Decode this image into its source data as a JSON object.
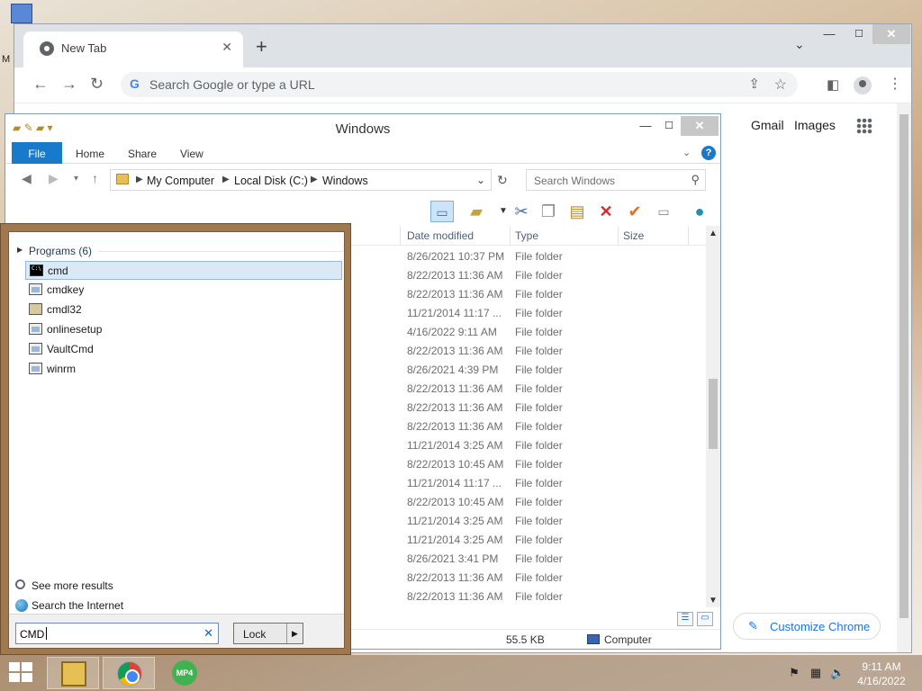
{
  "chrome": {
    "tab_title": "New Tab",
    "omnibox_placeholder": "Search Google or type a URL",
    "links": {
      "gmail": "Gmail",
      "images": "Images"
    },
    "customize_label": "Customize Chrome"
  },
  "explorer": {
    "title": "Windows",
    "ribbon_tabs": [
      "File",
      "Home",
      "Share",
      "View"
    ],
    "breadcrumb": [
      "My Computer",
      "Local Disk (C:)",
      "Windows"
    ],
    "search_placeholder": "Search Windows",
    "columns": [
      "Date modified",
      "Type",
      "Size"
    ],
    "rows": [
      {
        "date": "8/26/2021 10:37 PM",
        "type": "File folder"
      },
      {
        "date": "8/22/2013 11:36 AM",
        "type": "File folder"
      },
      {
        "date": "8/22/2013 11:36 AM",
        "type": "File folder"
      },
      {
        "date": "11/21/2014 11:17 ...",
        "type": "File folder"
      },
      {
        "date": "4/16/2022 9:11 AM",
        "type": "File folder"
      },
      {
        "date": "8/22/2013 11:36 AM",
        "type": "File folder"
      },
      {
        "date": "8/26/2021 4:39 PM",
        "type": "File folder"
      },
      {
        "date": "8/22/2013 11:36 AM",
        "type": "File folder"
      },
      {
        "date": "8/22/2013 11:36 AM",
        "type": "File folder"
      },
      {
        "date": "8/22/2013 11:36 AM",
        "type": "File folder"
      },
      {
        "date": "11/21/2014 3:25 AM",
        "type": "File folder"
      },
      {
        "date": "8/22/2013 10:45 AM",
        "type": "File folder"
      },
      {
        "date": "11/21/2014 11:17 ...",
        "type": "File folder"
      },
      {
        "date": "8/22/2013 10:45 AM",
        "type": "File folder"
      },
      {
        "date": "11/21/2014 3:25 AM",
        "type": "File folder"
      },
      {
        "date": "11/21/2014 3:25 AM",
        "type": "File folder"
      },
      {
        "date": "8/26/2021 3:41 PM",
        "type": "File folder"
      },
      {
        "date": "8/22/2013 11:36 AM",
        "type": "File folder"
      },
      {
        "date": "8/22/2013 11:36 AM",
        "type": "File folder"
      }
    ],
    "status_size": "55.5 KB",
    "status_location": "Computer"
  },
  "start_search": {
    "group_label": "Programs (6)",
    "items": [
      "cmd",
      "cmdkey",
      "cmdl32",
      "onlinesetup",
      "VaultCmd",
      "winrm"
    ],
    "see_more": "See more results",
    "search_internet": "Search the Internet",
    "query": "CMD",
    "lock_label": "Lock"
  },
  "taskbar": {
    "time": "9:11 AM",
    "date": "4/16/2022",
    "mp4_label": "MP4"
  }
}
